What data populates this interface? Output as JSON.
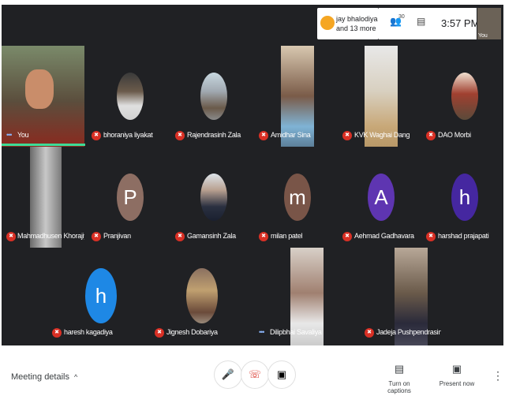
{
  "topbar": {
    "presenter_name": "jay bhalodiya",
    "presenter_more": "and 13 more",
    "people_count": "30",
    "time": "3:57 PM",
    "self_label": "You",
    "icons": [
      "people-icon",
      "chat-icon"
    ]
  },
  "participants": [
    {
      "name": "You",
      "muted": false,
      "kind": "video"
    },
    {
      "name": "bhoraniya liyakat",
      "muted": true,
      "kind": "photo"
    },
    {
      "name": "Rajendrasinh Zala",
      "muted": true,
      "kind": "photo"
    },
    {
      "name": "Amidhar Sina",
      "muted": true,
      "kind": "video"
    },
    {
      "name": "KVK Waghai Dang",
      "muted": true,
      "kind": "video"
    },
    {
      "name": "DAO Morbi",
      "muted": true,
      "kind": "photo"
    },
    {
      "name": "Mahmadhusen Khorajiya",
      "muted": true,
      "kind": "video"
    },
    {
      "name": "Pranjivan",
      "muted": true,
      "kind": "letter",
      "letter": "P",
      "color": "#8d6e63"
    },
    {
      "name": "Gamansinh Zala",
      "muted": true,
      "kind": "photo"
    },
    {
      "name": "milan patel",
      "muted": true,
      "kind": "letter",
      "letter": "m",
      "color": "#795548"
    },
    {
      "name": "Aehmad Gadhavara",
      "muted": true,
      "kind": "letter",
      "letter": "A",
      "color": "#5e35b1"
    },
    {
      "name": "harshad prajapati",
      "muted": true,
      "kind": "letter",
      "letter": "h",
      "color": "#4527a0"
    },
    {
      "name": "haresh kagadiya",
      "muted": true,
      "kind": "letter",
      "letter": "h",
      "color": "#1e88e5"
    },
    {
      "name": "Jignesh Dobariya",
      "muted": true,
      "kind": "photo"
    },
    {
      "name": "Dilipbhai Savaliya",
      "muted": false,
      "kind": "video"
    },
    {
      "name": "Jadeja Pushpendrasinh",
      "muted": true,
      "kind": "video"
    }
  ],
  "bottombar": {
    "meeting_details": "Meeting details",
    "chevron": "^",
    "captions_label": "Turn on captions",
    "present_label": "Present now",
    "icons": [
      "mic-icon",
      "end-call-icon",
      "camera-icon",
      "captions-icon",
      "present-icon",
      "more-icon"
    ]
  },
  "colors": {
    "stage": "#202124",
    "muted": "#d93025",
    "speaking": "#3ddc97"
  }
}
